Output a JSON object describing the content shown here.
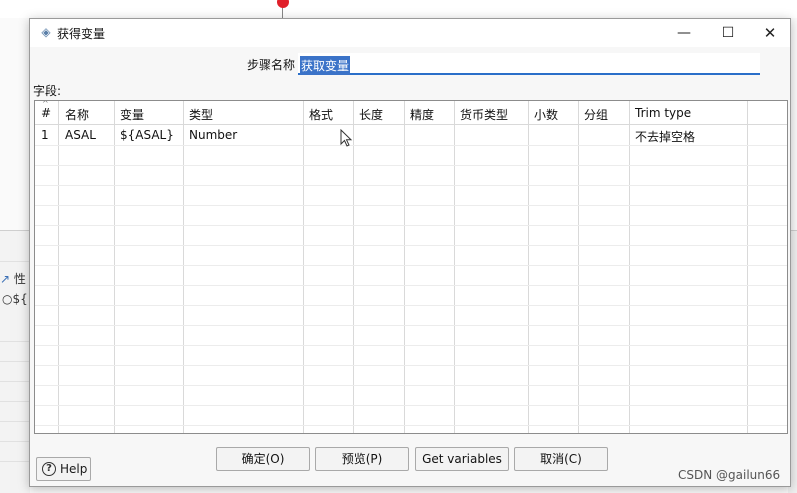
{
  "window": {
    "title": "获得变量",
    "minimize_glyph": "—",
    "maximize_glyph": "☐",
    "close_glyph": "✕"
  },
  "step": {
    "label": "步骤名称",
    "value": "获取变量"
  },
  "fields": {
    "label": "字段:",
    "columns": [
      "#",
      "名称",
      "变量",
      "类型",
      "格式",
      "长度",
      "精度",
      "货币类型",
      "小数",
      "分组",
      "Trim type"
    ],
    "rows": [
      [
        "1",
        "ASAL",
        "${ASAL}",
        "Number",
        "",
        "",
        "",
        "",
        "",
        "",
        "不去掉空格"
      ]
    ]
  },
  "buttons": {
    "ok": "确定(O)",
    "preview": "预览(P)",
    "get_variables": "Get variables",
    "cancel": "取消(C)",
    "help": "Help"
  },
  "background": {
    "tab_label": "性",
    "radio_label": "${"
  },
  "watermark": "CSDN @gailun66",
  "colors": {
    "selection": "#3b73c8",
    "focus_underline": "#2a6fc9",
    "window_bg": "#f7f7f7"
  },
  "icons": {
    "title": "diamond-step-icon",
    "help": "help-circle-icon",
    "cursor": "mouse-pointer-icon"
  }
}
